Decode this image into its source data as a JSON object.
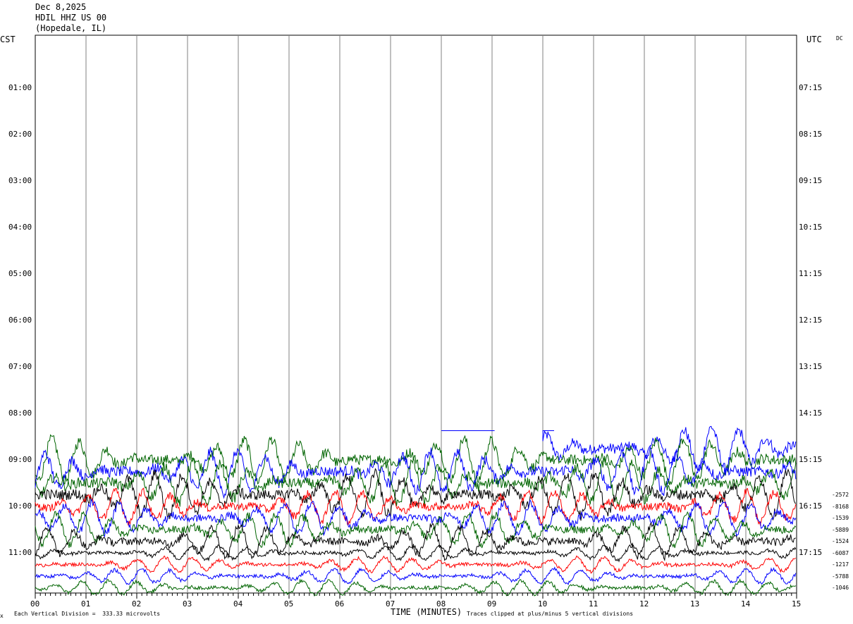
{
  "header": {
    "date": "Dec 8,2025",
    "station": "HDIL HHZ US 00",
    "location": "(Hopedale, IL)"
  },
  "left_timezone": "CST",
  "right_timezone": "UTC",
  "dc_label": "DC",
  "footer": {
    "corner_mark": "x",
    "division_note": "Each Vertical Division =  333.33 microvolts",
    "xaxis_title": "TIME (MINUTES)",
    "clip_note": "Traces clipped at plus/minus 5 vertical divisions"
  },
  "colors": {
    "black": "#000000",
    "red": "#ff0000",
    "blue": "#0000ff",
    "green": "#006400",
    "grid": "#808080"
  },
  "chart_data": {
    "type": "line",
    "title": "HDIL HHZ US 00",
    "xlabel": "TIME (MINUTES)",
    "x_ticks": [
      "00",
      "01",
      "02",
      "03",
      "04",
      "05",
      "06",
      "07",
      "08",
      "09",
      "10",
      "11",
      "12",
      "13",
      "14",
      "15"
    ],
    "xlim": [
      0,
      15
    ],
    "left_hour_labels": [
      "01:00",
      "02:00",
      "03:00",
      "04:00",
      "05:00",
      "06:00",
      "07:00",
      "08:00",
      "09:00",
      "10:00",
      "11:00"
    ],
    "right_hour_labels": [
      "07:15",
      "08:15",
      "09:15",
      "10:15",
      "11:15",
      "12:15",
      "13:15",
      "14:15",
      "15:15",
      "16:15",
      "17:15"
    ],
    "dc_offsets": [
      "-2572",
      "-8168",
      "-1539",
      "-5889",
      "-1524",
      "-6087",
      "-1217",
      "-5788",
      "-1046"
    ],
    "trace_colors": [
      "black",
      "red",
      "blue",
      "green"
    ],
    "blue_step_segment": {
      "row": "08:15",
      "from_minute": 8.0,
      "to_minute": 9.05
    },
    "active_rows": [
      {
        "row": "08:45",
        "color": "blue",
        "from_minute": 10.0
      },
      {
        "row": "09:00",
        "color": "green"
      },
      {
        "row": "09:15",
        "color": "blue"
      },
      {
        "row": "09:30",
        "color": "green"
      },
      {
        "row": "09:45",
        "color": "black"
      },
      {
        "row": "10:00",
        "color": "red"
      },
      {
        "row": "10:15",
        "color": "blue"
      },
      {
        "row": "10:30",
        "color": "green"
      },
      {
        "row": "10:45",
        "color": "black"
      },
      {
        "row": "11:00",
        "color": "black"
      },
      {
        "row": "11:15",
        "color": "red"
      },
      {
        "row": "11:30",
        "color": "blue"
      },
      {
        "row": "11:45",
        "color": "green"
      }
    ]
  }
}
